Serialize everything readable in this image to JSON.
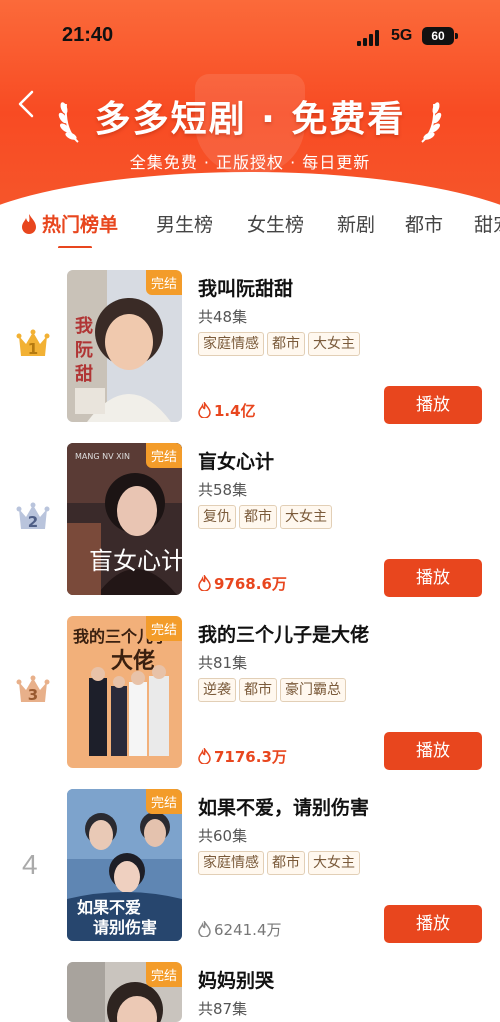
{
  "status": {
    "time": "21:40",
    "network": "5G",
    "battery": "60"
  },
  "header": {
    "title": "多多短剧 · 免费看",
    "subtitle": "全集免费 · 正版授权 · 每日更新"
  },
  "tabs": [
    "热门榜单",
    "男生榜",
    "女生榜",
    "新剧",
    "都市",
    "甜宠"
  ],
  "active_tab": "热门榜单",
  "colors": {
    "accent": "#e8461e",
    "header": "#f84b23",
    "badge": "#f39c2a",
    "gold": "#f2b134",
    "silver": "#b9c4dc",
    "bronze": "#e8b08a"
  },
  "items": [
    {
      "rank": "1",
      "badge": "完结",
      "title": "我叫阮甜甜",
      "episodes": "共48集",
      "tags": [
        "家庭情感",
        "都市",
        "大女主"
      ],
      "views": "1.4亿",
      "play": "播放"
    },
    {
      "rank": "2",
      "badge": "完结",
      "title": "盲女心计",
      "episodes": "共58集",
      "tags": [
        "复仇",
        "都市",
        "大女主"
      ],
      "views": "9768.6万",
      "play": "播放"
    },
    {
      "rank": "3",
      "badge": "完结",
      "title": "我的三个儿子是大佬",
      "episodes": "共81集",
      "tags": [
        "逆袭",
        "都市",
        "豪门霸总"
      ],
      "views": "7176.3万",
      "play": "播放"
    },
    {
      "rank": "4",
      "badge": "完结",
      "title": "如果不爱，请别伤害",
      "episodes": "共60集",
      "tags": [
        "家庭情感",
        "都市",
        "大女主"
      ],
      "views": "6241.4万",
      "play": "播放"
    },
    {
      "rank": "",
      "badge": "完结",
      "title": "妈妈别哭",
      "episodes": "共87集"
    }
  ]
}
